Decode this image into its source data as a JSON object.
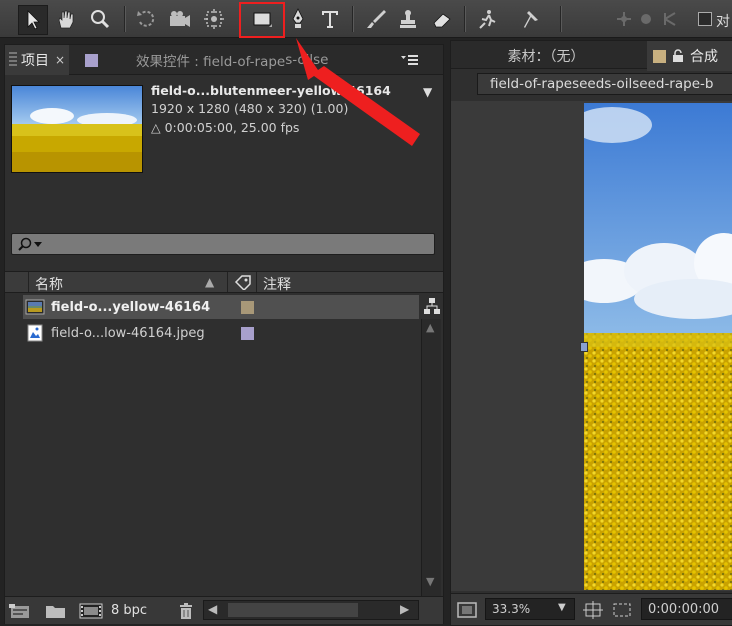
{
  "project_panel": {
    "tab_project": "项目",
    "tab_close": "×",
    "tab_effects": "效果控件 : field-of-rape",
    "tab_effects_tail": "s-oilse",
    "menu_icon": "menu-icon",
    "footage_name": "field-o...blutenmeer-yellow-46164",
    "footage_dims": "1920 x 1280  (480 x 320) (1.00)",
    "footage_duration": "△ 0:00:05:00, 25.00 fps",
    "search_placeholder": "",
    "col_name": "名称",
    "col_comment": "注释",
    "items": [
      {
        "name": "field-o...yellow-46164",
        "type": "composition",
        "label_color": "#a89878"
      },
      {
        "name": "field-o...low-46164.jpeg",
        "type": "image",
        "label_color": "#a8a0cc"
      }
    ],
    "bpc": "8 bpc"
  },
  "viewer_panel": {
    "tab_footage": "素材：（无）",
    "tab_comp": "合成",
    "dropdown_value": "field-of-rapeseeds-oilseed-rape-b",
    "zoom": "33.3%",
    "timecode": "0:00:00:00"
  },
  "toolbar": {
    "tools": [
      "selection-tool",
      "hand-tool",
      "zoom-tool",
      "rotation-tool",
      "camera-tool",
      "pan-behind-tool",
      "rectangle-tool",
      "pen-tool",
      "type-tool",
      "brush-tool",
      "clone-stamp-tool",
      "eraser-tool",
      "roto-brush-tool",
      "puppet-tool"
    ],
    "checkbox_label": "对"
  },
  "colors": {
    "highlight": "#ee1f1f",
    "panel_bg": "#2f2f2f",
    "toolbar_bg": "#404040"
  }
}
